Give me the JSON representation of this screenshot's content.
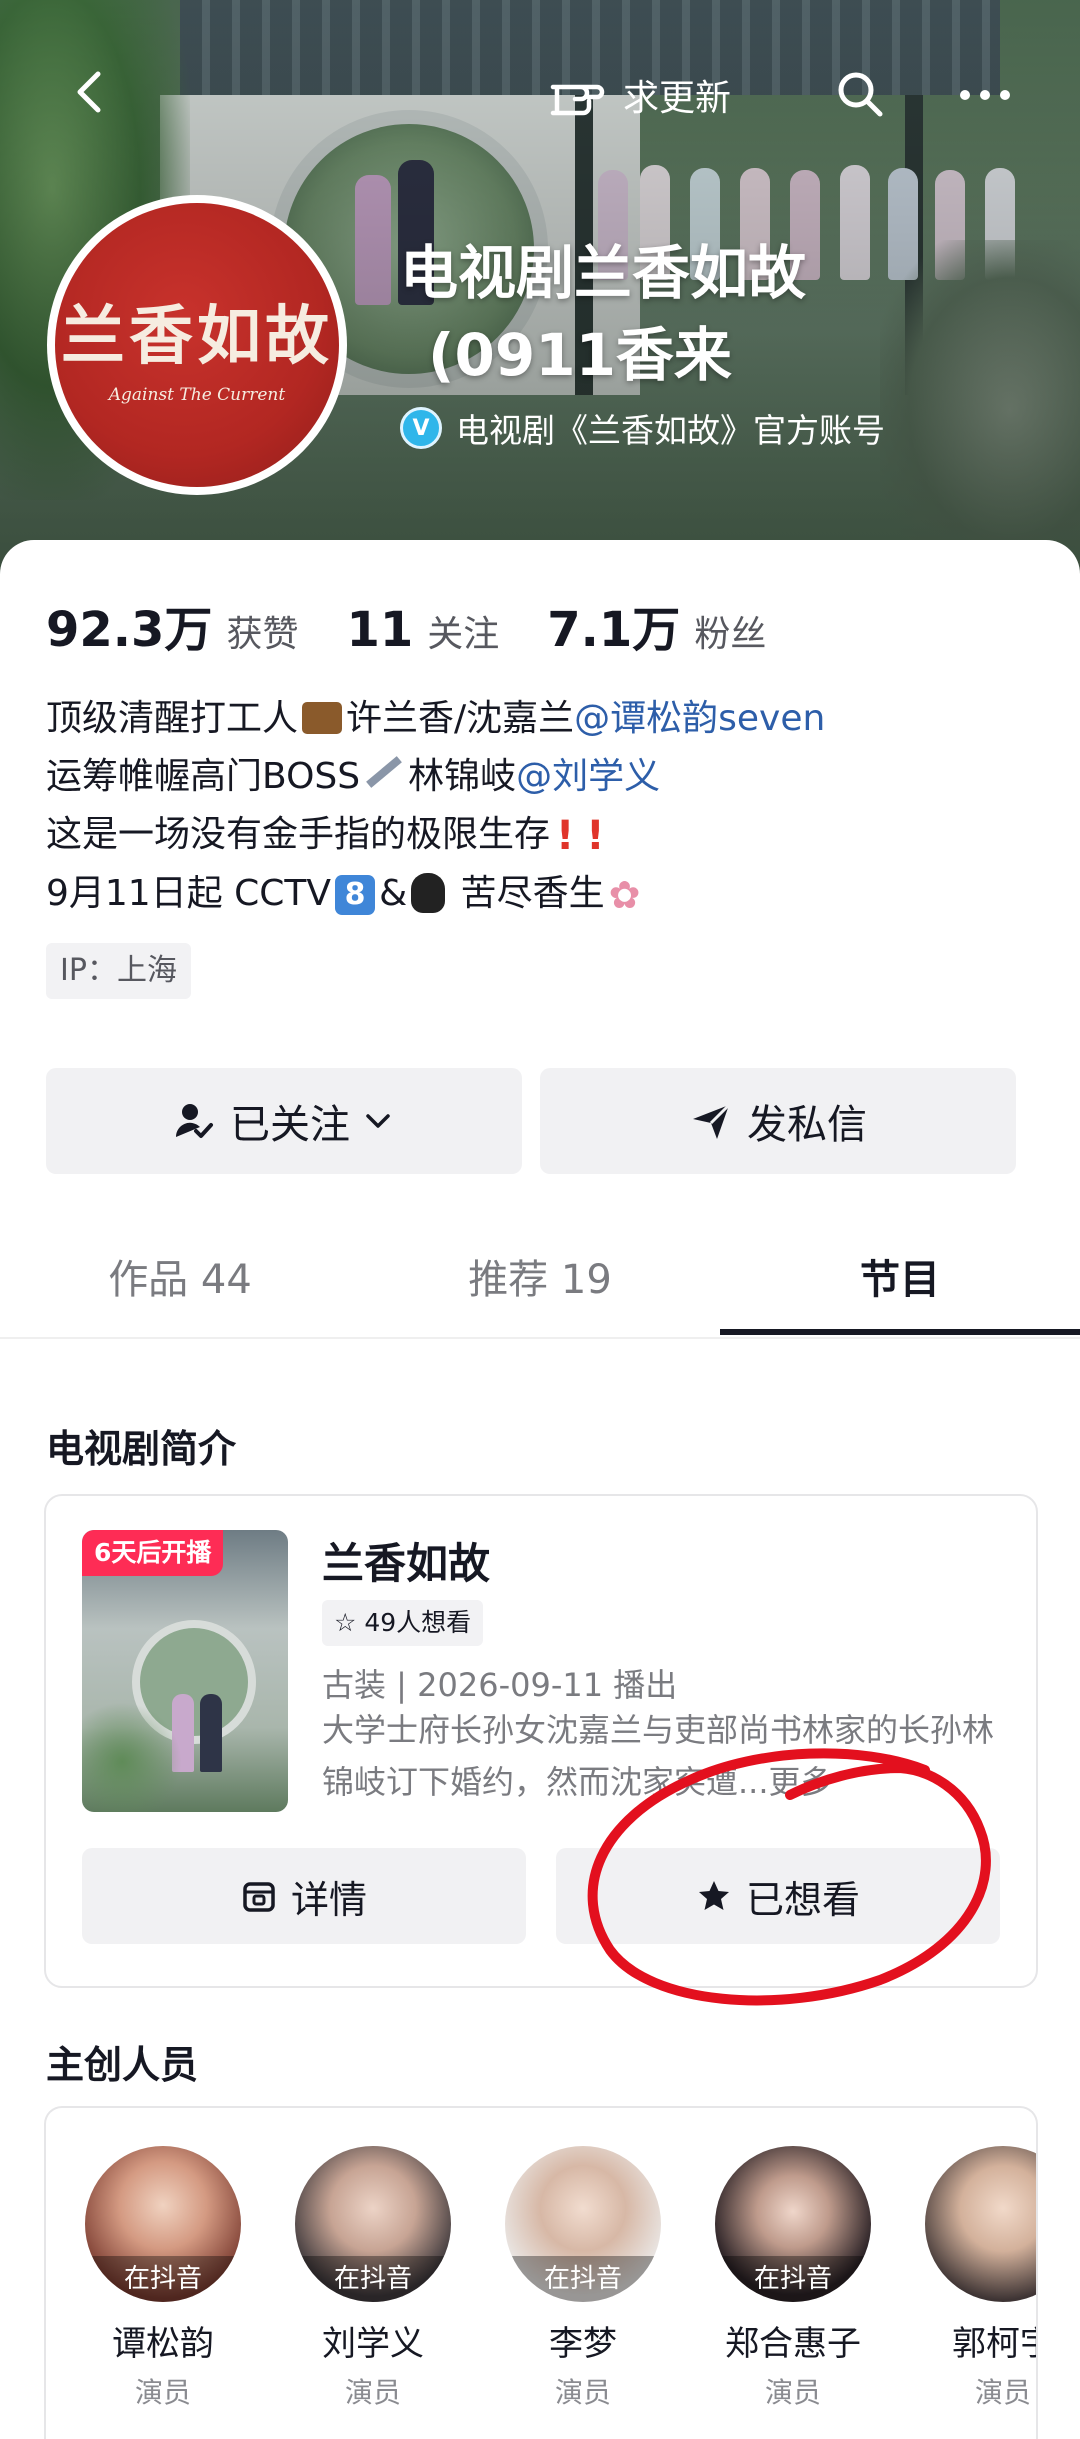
{
  "header": {
    "update_label": "求更新",
    "account_name_line1": "电视剧兰香如故",
    "account_name_line2": "(0911香来",
    "verified_text": "电视剧《兰香如故》官方账号",
    "avatar_logo_cn": "兰香如故",
    "avatar_logo_en": "Against The Current"
  },
  "stats": [
    {
      "value": "92.3万",
      "label": "获赞"
    },
    {
      "value": "11",
      "label": "关注"
    },
    {
      "value": "7.1万",
      "label": "粉丝"
    }
  ],
  "bio": {
    "line1_a": "顶级清醒打工人",
    "line1_b": "许兰香/沈嘉兰",
    "line1_mention": "@谭松韵seven",
    "line2_a": "运筹帷幄高门BOSS",
    "line2_b": "林锦岐",
    "line2_mention": "@刘学义",
    "line3": "这是一场没有金手指的极限生存",
    "line4_a": "9月11日起 CCTV",
    "line4_b": "&",
    "line4_c": "苦尽香生"
  },
  "ip_label": "IP：上海",
  "actions": {
    "follow_label": "已关注",
    "message_label": "发私信"
  },
  "tabs": [
    {
      "label": "作品 44"
    },
    {
      "label": "推荐 19"
    },
    {
      "label": "节目"
    }
  ],
  "drama_section": {
    "title": "电视剧简介",
    "badge": "6天后开播",
    "name": "兰香如故",
    "want_count": "49人想看",
    "meta": "古装 | 2026-09-11 播出",
    "description": "大学士府长孙女沈嘉兰与吏部尚书林家的长孙林锦岐订下婚约，然而沈家突遭...",
    "more": "更多",
    "details_label": "详情",
    "wanted_label": "已想看"
  },
  "crew_section": {
    "title": "主创人员",
    "tag": "在抖音",
    "people": [
      {
        "name": "谭松韵",
        "role": "演员"
      },
      {
        "name": "刘学义",
        "role": "演员"
      },
      {
        "name": "李梦",
        "role": "演员"
      },
      {
        "name": "郑合惠子",
        "role": "演员"
      },
      {
        "name": "郭柯宇",
        "role": "演员"
      }
    ]
  },
  "colors": {
    "accent_red": "#fe2c55",
    "mention_blue": "#2d5ea9",
    "verify_blue": "#2fb6ea",
    "avatar_red": "#b22722",
    "annotation_red": "#e3101e"
  }
}
